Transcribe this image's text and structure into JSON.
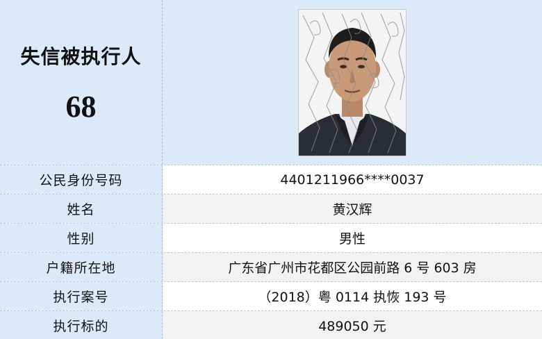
{
  "header": {
    "title": "失信被执行人",
    "number": "68"
  },
  "rows": [
    {
      "label": "公民身份号码",
      "value": "4401211966****0037"
    },
    {
      "label": "姓名",
      "value": "黄汉辉"
    },
    {
      "label": "性别",
      "value": "男性"
    },
    {
      "label": "户籍所在地",
      "value": "广东省广州市花都区公园前路 6 号 603 房"
    },
    {
      "label": "执行案号",
      "value": "（2018）粤 0114 执恢 193 号"
    },
    {
      "label": "执行标的",
      "value": "489050 元"
    }
  ],
  "colors": {
    "label_bg": "#dbe9f9",
    "value_bg": "#ffffff",
    "value_bg_alt": "#f2f2f2",
    "divider": "#b9c6d2"
  }
}
